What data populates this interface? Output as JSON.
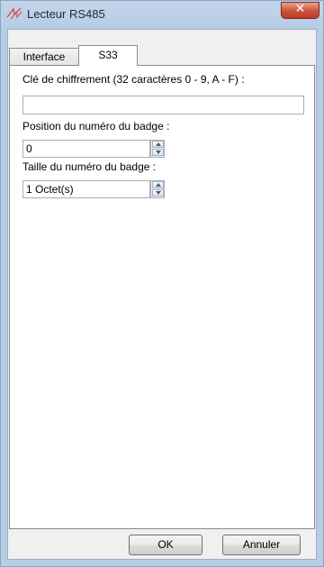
{
  "window": {
    "title": "Lecteur RS485",
    "close_glyph": "✕",
    "icon": "rs485-reader-icon"
  },
  "tabs": [
    {
      "label": "Interface",
      "selected": false
    },
    {
      "label": "S33",
      "selected": true
    }
  ],
  "form": {
    "encryption_key_label": "Clé de chiffrement (32 caractères 0 - 9, A - F) :",
    "encryption_key_value": "",
    "badge_position_label": "Position du numéro du badge :",
    "badge_position_value": "0",
    "badge_size_label": "Taille du numéro du badge :",
    "badge_size_value": "1 Octet(s)"
  },
  "buttons": {
    "ok": "OK",
    "cancel": "Annuler"
  }
}
